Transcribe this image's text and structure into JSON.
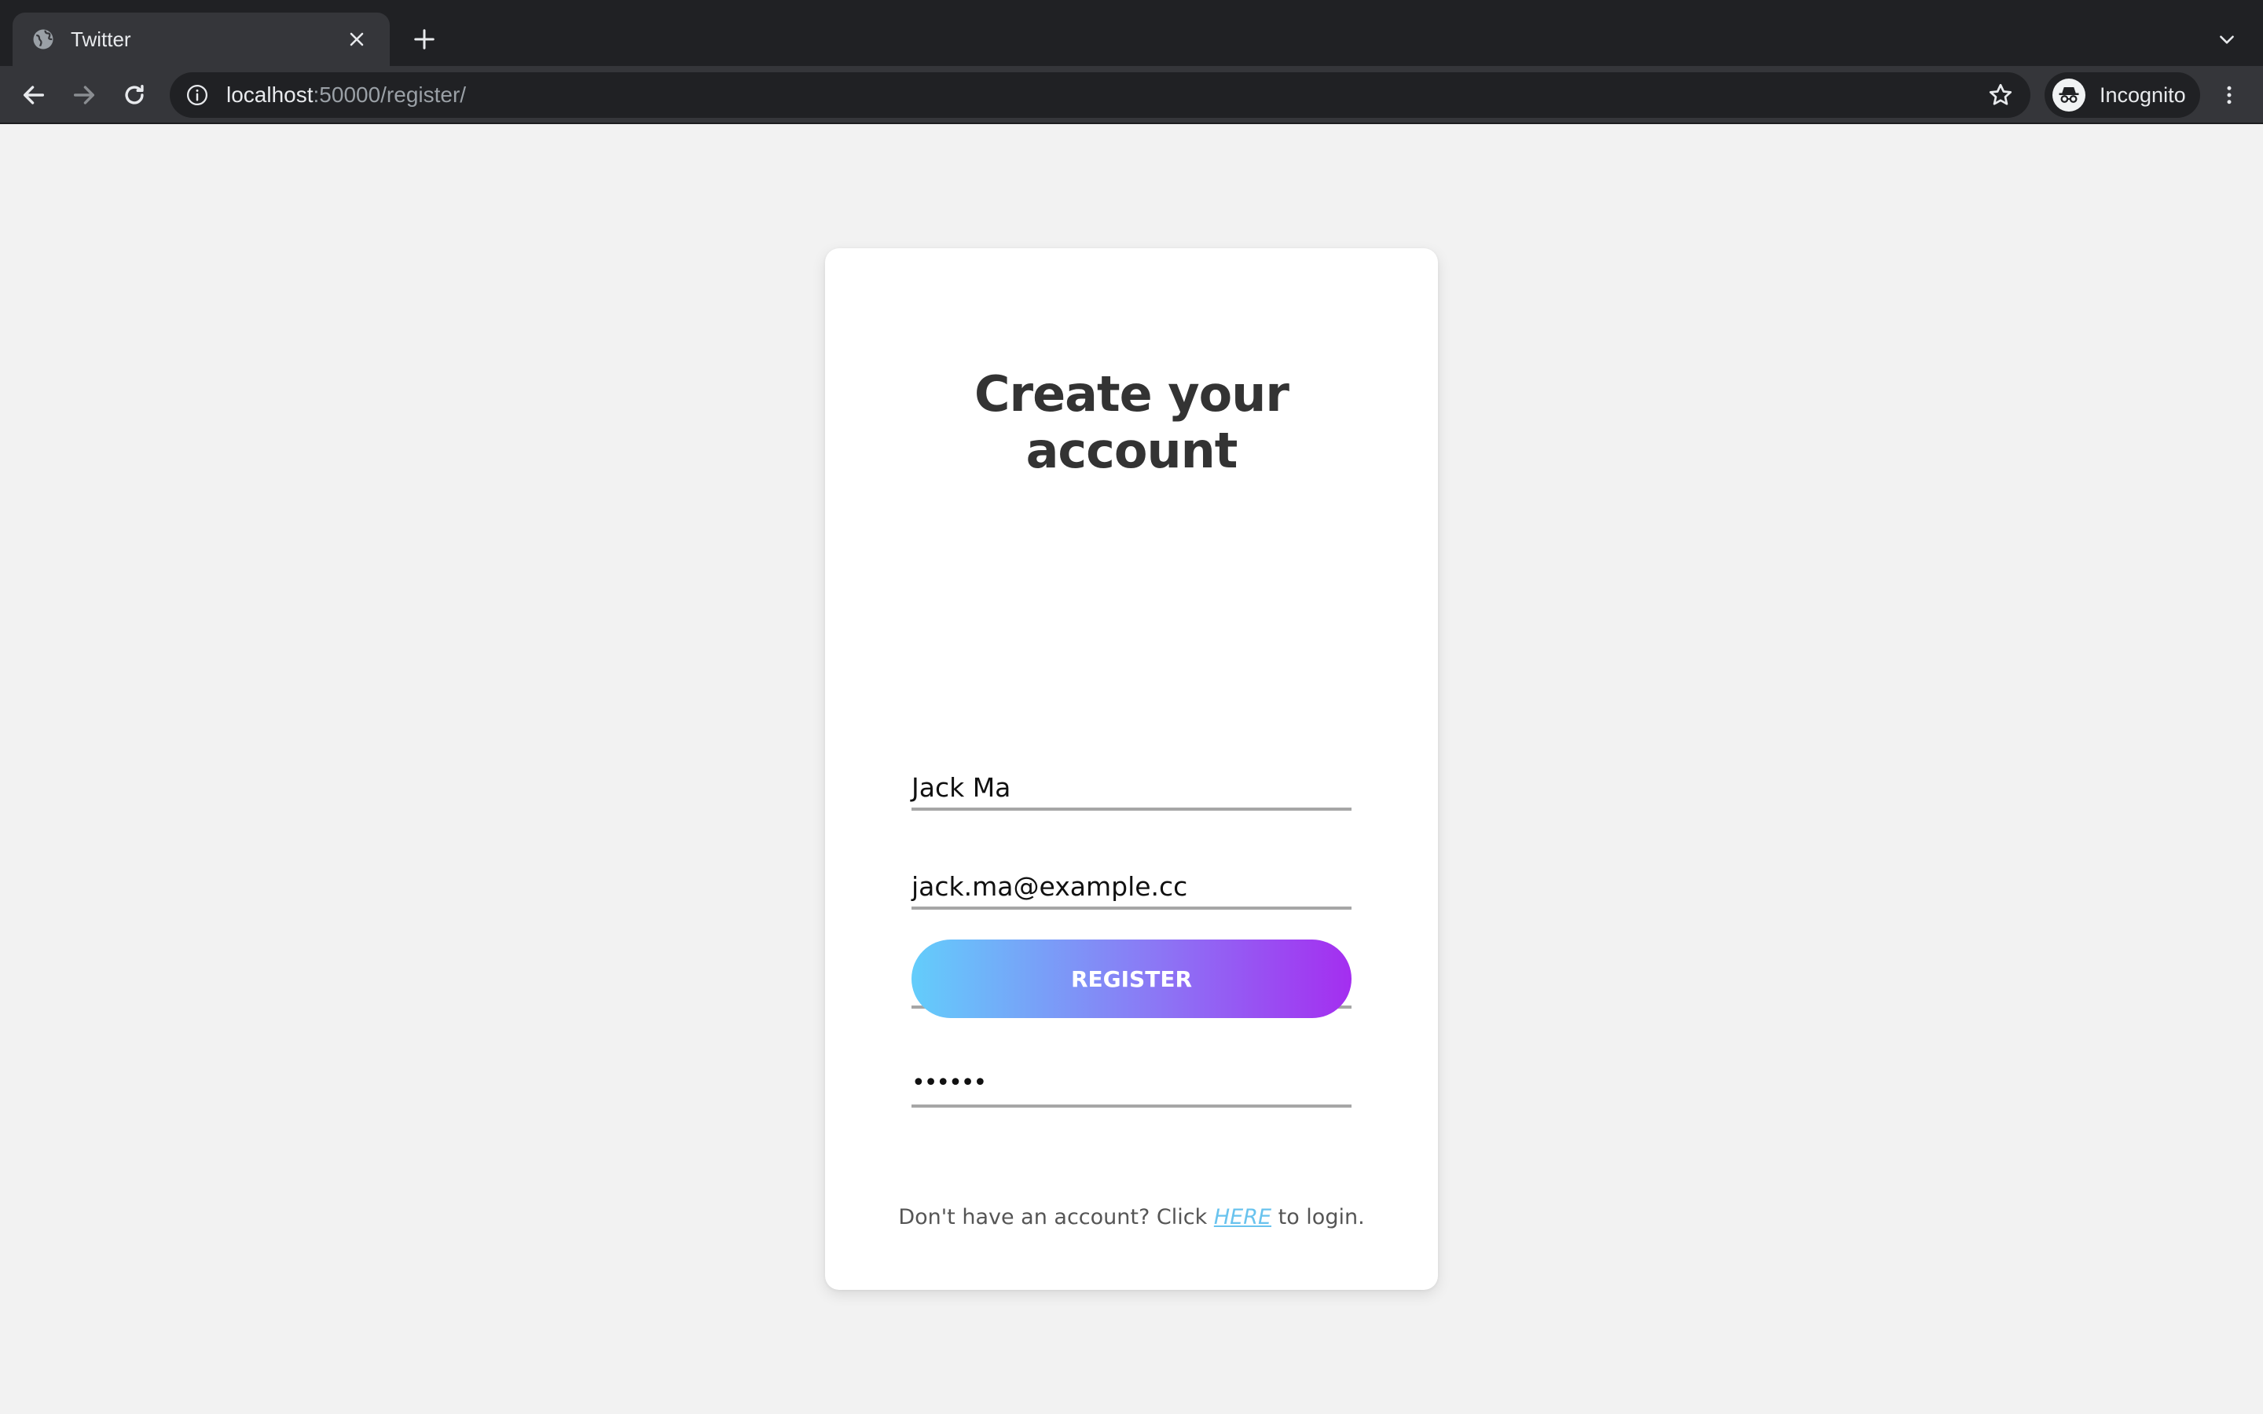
{
  "browser": {
    "tab_title": "Twitter",
    "url_host": "localhost",
    "url_rest": ":50000/register/",
    "profile_label": "Incognito"
  },
  "form": {
    "heading_line1": "Create your",
    "heading_line2": "account",
    "name_value": "Jack Ma",
    "email_value": "jack.ma@example.cc",
    "password_value": "••••••",
    "confirm_value": "••••••",
    "submit_label": "REGISTER",
    "footer_prefix": "Don't have an account? Click",
    "footer_link": "HERE",
    "footer_suffix": "to login."
  },
  "colors": {
    "page_background": "#f2f2f2",
    "button_gradient_start": "#63cdfb",
    "button_gradient_end": "#a42ef0",
    "link": "#69c3ee"
  },
  "icons": [
    "globe-icon",
    "close-icon",
    "plus-icon",
    "chevron-down-icon",
    "back-arrow-icon",
    "forward-arrow-icon",
    "reload-icon",
    "info-icon",
    "star-icon",
    "incognito-icon",
    "more-vert-icon"
  ]
}
